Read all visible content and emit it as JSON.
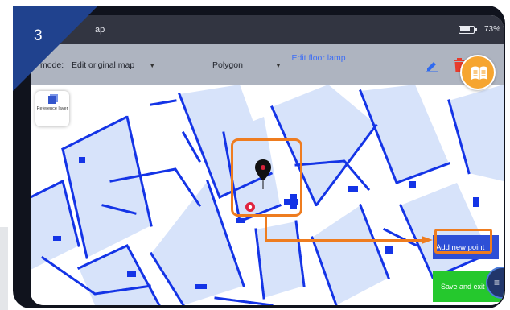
{
  "step_number": "3",
  "statusbar": {
    "title_fragment": "ap",
    "battery": "73%"
  },
  "toolbar": {
    "mode_label": "mode:",
    "mode_value": "Edit original map",
    "shape_value": "Polygon",
    "edit_link": "Edit floor lamp"
  },
  "map": {
    "reference_layer": "Reference layer",
    "add_point_label": "Add new point",
    "save_exit_label": "Save and exit"
  },
  "colors": {
    "accent": "#ee7c1f",
    "map_blue": "#1434e6",
    "badge": "#20428e",
    "add_button": "#2e4fd6",
    "save_button": "#25c82d",
    "delete_red": "#e83b2c"
  },
  "icons": [
    "pencil-icon",
    "trash-icon",
    "book-icon",
    "location-pin-icon",
    "robot-position-icon",
    "menu-icon"
  ]
}
